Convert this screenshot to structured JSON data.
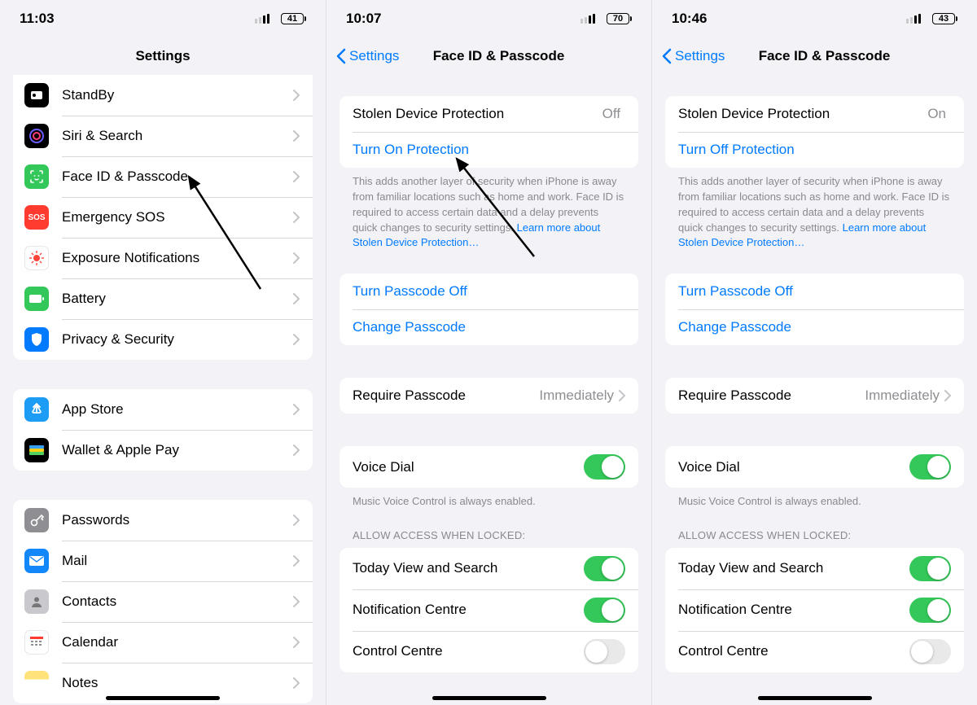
{
  "phone1": {
    "time": "11:03",
    "battery": "41",
    "title": "Settings",
    "group1": [
      {
        "label": "StandBy",
        "icon": "ic-standby"
      },
      {
        "label": "Siri & Search",
        "icon": "ic-siri"
      },
      {
        "label": "Face ID & Passcode",
        "icon": "ic-faceid"
      },
      {
        "label": "Emergency SOS",
        "icon": "ic-sos"
      },
      {
        "label": "Exposure Notifications",
        "icon": "ic-exposure"
      },
      {
        "label": "Battery",
        "icon": "ic-battery"
      },
      {
        "label": "Privacy & Security",
        "icon": "ic-privacy"
      }
    ],
    "group2": [
      {
        "label": "App Store",
        "icon": "ic-appstore"
      },
      {
        "label": "Wallet & Apple Pay",
        "icon": "ic-wallet"
      }
    ],
    "group3": [
      {
        "label": "Passwords",
        "icon": "ic-passwords"
      },
      {
        "label": "Mail",
        "icon": "ic-mail"
      },
      {
        "label": "Contacts",
        "icon": "ic-contacts"
      },
      {
        "label": "Calendar",
        "icon": "ic-calendar"
      },
      {
        "label": "Notes",
        "icon": "ic-notes"
      }
    ]
  },
  "phone2": {
    "time": "10:07",
    "battery": "70",
    "back": "Settings",
    "title": "Face ID & Passcode",
    "sdp_label": "Stolen Device Protection",
    "sdp_value": "Off",
    "sdp_action": "Turn On Protection",
    "sdp_footer": "This adds another layer of security when iPhone is away from familiar locations such as home and work. Face ID is required to access certain data and a delay prevents quick changes to security settings. ",
    "sdp_learn": "Learn more about Stolen Device Protection…",
    "passcode_off": "Turn Passcode Off",
    "change_passcode": "Change Passcode",
    "require_label": "Require Passcode",
    "require_value": "Immediately",
    "voice_dial": "Voice Dial",
    "voice_footer": "Music Voice Control is always enabled.",
    "allow_header": "ALLOW ACCESS WHEN LOCKED:",
    "locked": [
      {
        "label": "Today View and Search",
        "on": true
      },
      {
        "label": "Notification Centre",
        "on": true
      },
      {
        "label": "Control Centre",
        "on": false
      }
    ]
  },
  "phone3": {
    "time": "10:46",
    "battery": "43",
    "back": "Settings",
    "title": "Face ID & Passcode",
    "sdp_label": "Stolen Device Protection",
    "sdp_value": "On",
    "sdp_action": "Turn Off Protection",
    "sdp_footer": "This adds another layer of security when iPhone is away from familiar locations such as home and work. Face ID is required to access certain data and a delay prevents quick changes to security settings. ",
    "sdp_learn": "Learn more about Stolen Device Protection…",
    "passcode_off": "Turn Passcode Off",
    "change_passcode": "Change Passcode",
    "require_label": "Require Passcode",
    "require_value": "Immediately",
    "voice_dial": "Voice Dial",
    "voice_footer": "Music Voice Control is always enabled.",
    "allow_header": "ALLOW ACCESS WHEN LOCKED:",
    "locked": [
      {
        "label": "Today View and Search",
        "on": true
      },
      {
        "label": "Notification Centre",
        "on": true
      },
      {
        "label": "Control Centre",
        "on": false
      }
    ]
  }
}
